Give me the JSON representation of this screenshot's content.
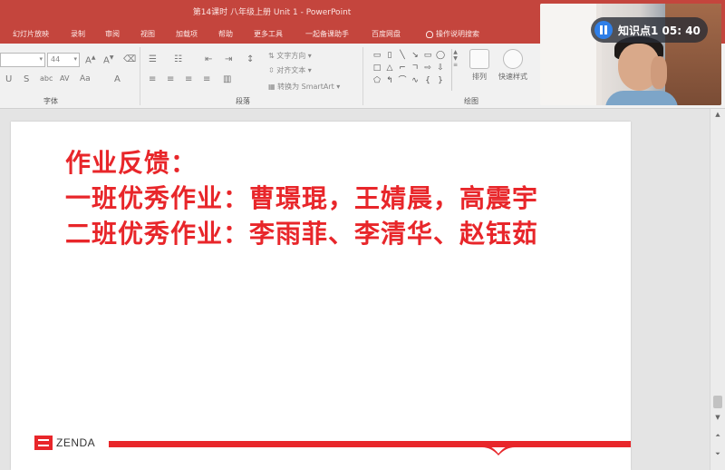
{
  "window": {
    "title": "第14课时  八年级上册  Unit 1  -  PowerPoint"
  },
  "tabs": [
    {
      "label": "幻灯片放映"
    },
    {
      "label": "录制"
    },
    {
      "label": "审阅"
    },
    {
      "label": "视图"
    },
    {
      "label": "加载项"
    },
    {
      "label": "帮助"
    },
    {
      "label": "更多工具"
    },
    {
      "label": "一起备课助手"
    },
    {
      "label": "百度网盘"
    },
    {
      "label": "操作说明搜索"
    }
  ],
  "ribbon": {
    "font_size_value": "44",
    "text_direction_label": "文字方向",
    "align_text_label": "对齐文本",
    "smartart_label": "转换为 SmartArt",
    "arrange_label": "排列",
    "quick_styles_label": "快速样式",
    "groups": {
      "font": "字体",
      "paragraph": "段落",
      "drawing": "绘图"
    }
  },
  "video": {
    "badge_text": "知识点1 05: 40",
    "accent": "#2f7fe8"
  },
  "slide": {
    "line1": "作业反馈：",
    "line2": "一班优秀作业：曹璟琨，王婧晨，高震宇",
    "line3": "二班优秀作业：李雨菲、李清华、赵钰茹",
    "logo_text": "ZENDA",
    "text_color": "#e8262a"
  },
  "colors": {
    "ribbon_brand": "#c4453d",
    "slide_text": "#e8262a"
  }
}
